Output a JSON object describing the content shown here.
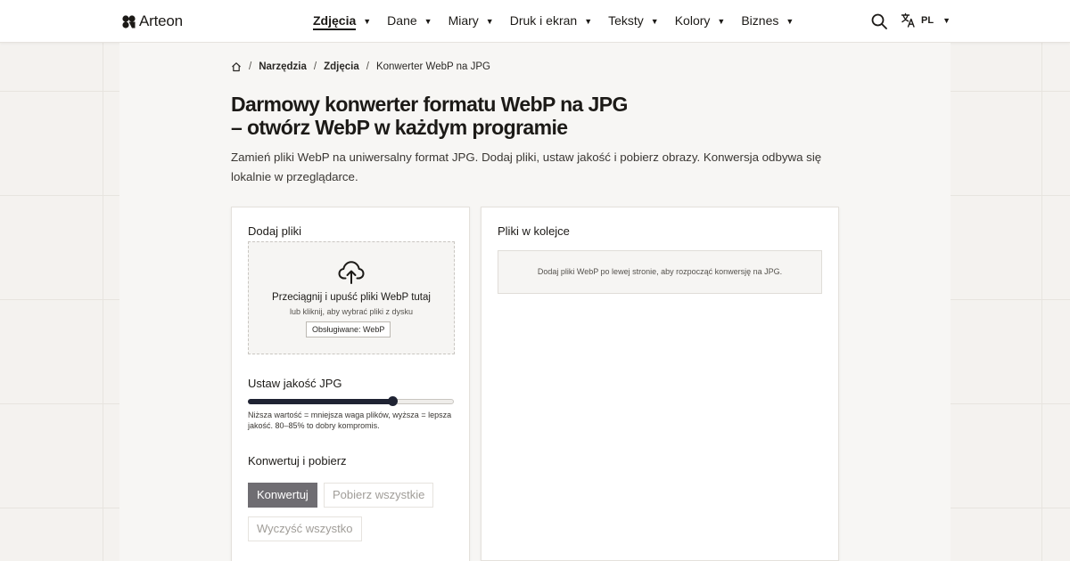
{
  "brand": {
    "name": "Arteon",
    "logo_icon": "arteon-logo"
  },
  "nav": {
    "items": [
      {
        "label": "Zdjęcia",
        "active": true
      },
      {
        "label": "Dane",
        "active": false
      },
      {
        "label": "Miary",
        "active": false
      },
      {
        "label": "Druk i ekran",
        "active": false
      },
      {
        "label": "Teksty",
        "active": false
      },
      {
        "label": "Kolory",
        "active": false
      },
      {
        "label": "Biznes",
        "active": false
      }
    ],
    "search_icon": "search-icon",
    "language": {
      "icon": "translate-icon",
      "code": "PL"
    }
  },
  "breadcrumb": {
    "home_icon": "home-icon",
    "items": [
      "Narzędzia",
      "Zdjęcia"
    ],
    "current": "Konwerter WebP na JPG"
  },
  "page": {
    "title": "Darmowy konwerter formatu WebP na JPG – otwórz WebP w każdym programie",
    "lead": "Zamień pliki WebP na uniwersalny format JPG. Dodaj pliki, ustaw jakość i pobierz obrazy. Konwersja odbywa się lokalnie w przeglądarce."
  },
  "upload": {
    "title": "Dodaj pliki",
    "drop_title": "Przeciągnij i upuść pliki WebP tutaj",
    "drop_sub": "lub kliknij, aby wybrać pliki z dysku",
    "badge": "Obsługiwane: WebP",
    "icon": "cloud-upload-icon"
  },
  "quality": {
    "title": "Ustaw jakość JPG",
    "value_fraction": 0.7,
    "hint": "Niższa wartość = mniejsza waga plików, wyższa = lepsza jakość. 80–85% to dobry kompromis."
  },
  "actions": {
    "title": "Konwertuj i pobierz",
    "convert": "Konwertuj",
    "download_all": "Pobierz wszystkie",
    "clear_all": "Wyczyść wszystko"
  },
  "queue": {
    "title": "Pliki w kolejce",
    "empty": "Dodaj pliki WebP po lewej stronie, aby rozpocząć konwersję na JPG."
  },
  "colors": {
    "accent": "#1f2333",
    "primary_button": "#6f6d72",
    "background": "#f4f2ef"
  }
}
